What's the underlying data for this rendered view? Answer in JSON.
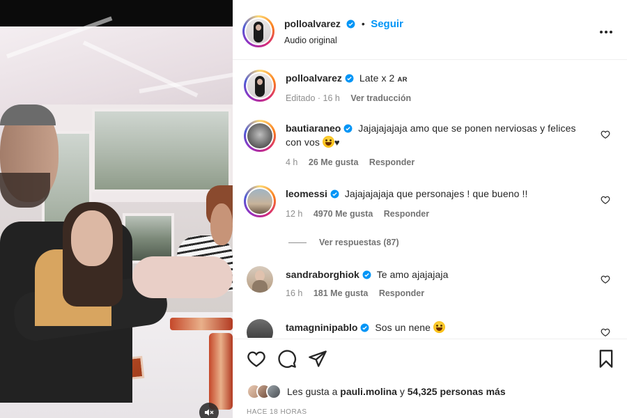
{
  "header": {
    "username": "polloalvarez",
    "separator": "•",
    "follow_label": "Seguir",
    "subtitle": "Audio original"
  },
  "caption": {
    "username": "polloalvarez",
    "text": "Late x 2",
    "flag_tag": "AR",
    "meta_time": "Editado · 16 h",
    "translate_label": "Ver traducción"
  },
  "comments": [
    {
      "username": "bautiaraneo",
      "text": "Jajajajajaja amo que se ponen nerviosas y felices con vos",
      "trailing": "♥",
      "time": "4 h",
      "likes": "26 Me gusta",
      "reply_label": "Responder"
    },
    {
      "username": "leomessi",
      "text": "Jajajajajaja que personajes ! que bueno !!",
      "time": "12 h",
      "likes": "4970 Me gusta",
      "reply_label": "Responder",
      "view_replies": "Ver respuestas (87)"
    },
    {
      "username": "sandraborghiok",
      "text": "Te amo ajajajaja",
      "time": "16 h",
      "likes": "181 Me gusta",
      "reply_label": "Responder"
    },
    {
      "username": "tamagninipablo",
      "text": "Sos un nene"
    }
  ],
  "likes_bar": {
    "prefix": "Les gusta a",
    "user": "pauli.molina",
    "conj": "y",
    "others": "54,325 personas más"
  },
  "time_ago": "HACE 18 HORAS",
  "colors": {
    "accent": "#0095f6",
    "verified": "#0095f6",
    "text": "#262626",
    "muted": "#8e8e8e"
  },
  "icons": [
    "verified-icon",
    "more-icon",
    "heart-icon",
    "comment-icon",
    "share-icon",
    "bookmark-icon",
    "mute-icon",
    "laughing-emoji-icon"
  ]
}
